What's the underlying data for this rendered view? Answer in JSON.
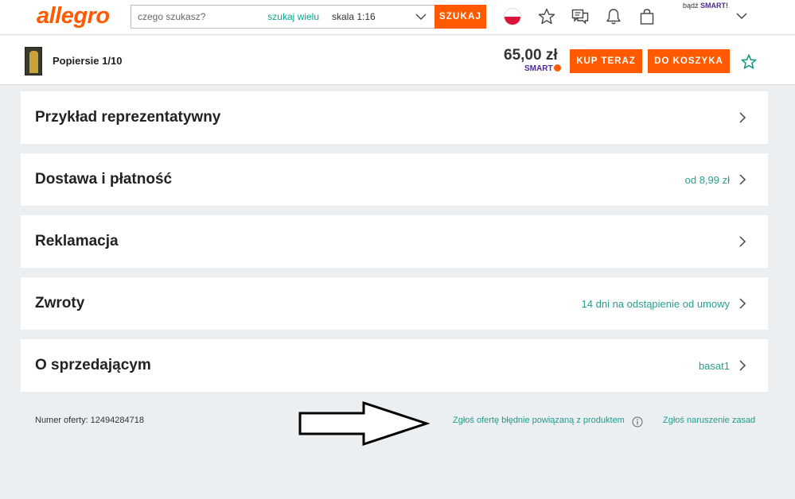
{
  "header": {
    "logo": "allegro",
    "search": {
      "placeholder": "czego szukasz?",
      "search_many": "szukaj wielu"
    },
    "category_select": {
      "value": "skala 1:16"
    },
    "search_button": "SZUKAJ",
    "smart_prefix": "bądź",
    "smart_brand": "SMART!"
  },
  "product_bar": {
    "title": "Popiersie 1/10",
    "price": "65,00 zł",
    "smart_label": "SMART",
    "buy_now": "KUP TERAZ",
    "add_to_cart": "DO KOSZYKA"
  },
  "sections": [
    {
      "title": "Przykład reprezentatywny",
      "value": ""
    },
    {
      "title": "Dostawa i płatność",
      "value": "od 8,99 zł"
    },
    {
      "title": "Reklamacja",
      "value": ""
    },
    {
      "title": "Zwroty",
      "value": "14 dni na odstąpienie od umowy"
    },
    {
      "title": "O sprzedającym",
      "value": "basat1"
    }
  ],
  "footer": {
    "offer_number": "Numer oferty: 12494284718",
    "report_wrong_product": "Zgłoś ofertę błędnie powiązaną z produktem",
    "report_violation": "Zgłoś naruszenie zasad"
  },
  "colors": {
    "accent": "#ff5a00",
    "link": "#1f9b8a",
    "smart": "#4c2a8c"
  },
  "icons": [
    "poland-flag-icon",
    "star-icon",
    "chat-icon",
    "bell-icon",
    "shopping-bag-icon",
    "chevron-down-icon",
    "chevron-right-icon",
    "info-icon",
    "arrow-annotation-icon"
  ]
}
